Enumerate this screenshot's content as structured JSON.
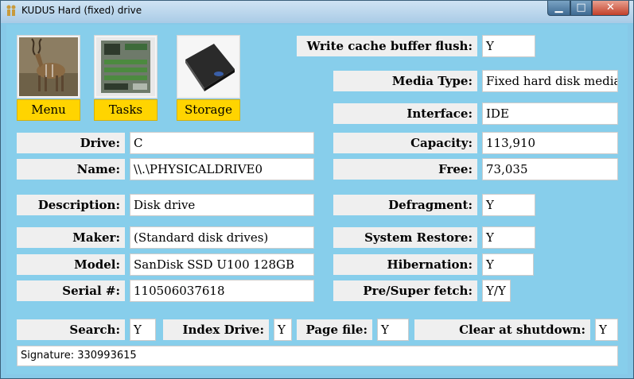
{
  "window": {
    "title": "KUDUS Hard (fixed) drive",
    "minimize_glyph": "▁",
    "maximize_glyph": "□",
    "close_glyph": "✕"
  },
  "tiles": [
    {
      "icon": "kudu-antelope-icon",
      "label": "Menu"
    },
    {
      "icon": "circuit-board-icon",
      "label": "Tasks"
    },
    {
      "icon": "hard-drive-icon",
      "label": "Storage"
    }
  ],
  "fields": {
    "drive": {
      "label": "Drive:",
      "value": "C"
    },
    "name": {
      "label": "Name:",
      "value": "\\\\.\\PHYSICALDRIVE0"
    },
    "description": {
      "label": "Description:",
      "value": "Disk drive"
    },
    "maker": {
      "label": "Maker:",
      "value": "(Standard disk drives)"
    },
    "model": {
      "label": "Model:",
      "value": "SanDisk SSD U100 128GB"
    },
    "serial": {
      "label": "Serial #:",
      "value": "110506037618"
    },
    "write_cache": {
      "label": "Write cache buffer flush:",
      "value": "Y"
    },
    "media_type": {
      "label": "Media Type:",
      "value": "Fixed hard disk media"
    },
    "interface": {
      "label": "Interface:",
      "value": "IDE"
    },
    "capacity": {
      "label": "Capacity:",
      "value": "113,910"
    },
    "free": {
      "label": "Free:",
      "value": "73,035"
    },
    "defragment": {
      "label": "Defragment:",
      "value": "Y"
    },
    "system_restore": {
      "label": "System Restore:",
      "value": "Y"
    },
    "hibernation": {
      "label": "Hibernation:",
      "value": "Y"
    },
    "prefetch": {
      "label": "Pre/Super fetch:",
      "value": "Y/Y"
    },
    "search": {
      "label": "Search:",
      "value": "Y"
    },
    "index_drive": {
      "label": "Index Drive:",
      "value": "Y"
    },
    "page_file": {
      "label": "Page file:",
      "value": "Y"
    },
    "clear_shutdown": {
      "label": "Clear at shutdown:",
      "value": "Y"
    }
  },
  "signature": "Signature: 330993615"
}
